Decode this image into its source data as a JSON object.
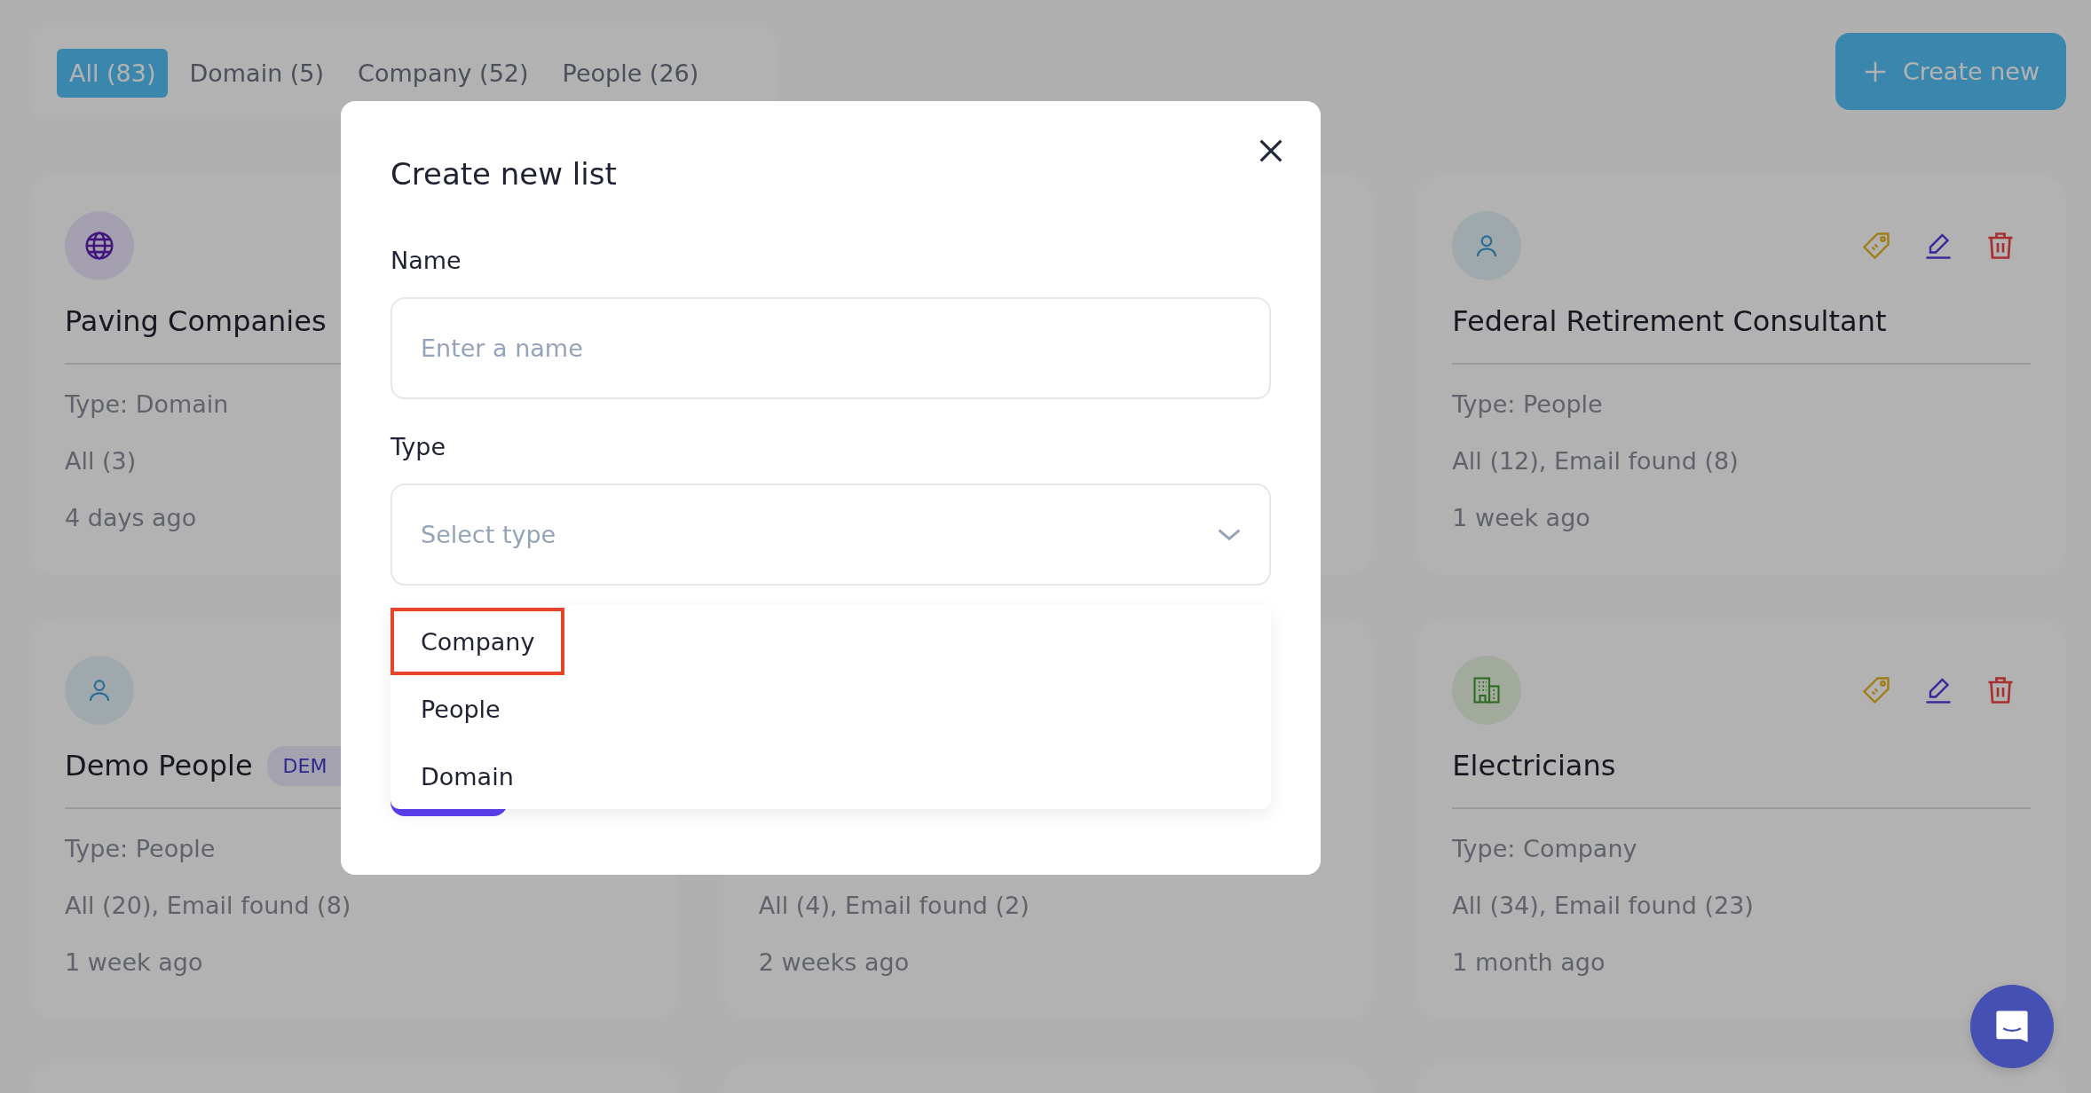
{
  "tabs": [
    {
      "label": "All (83)",
      "selected": true
    },
    {
      "label": "Domain (5)",
      "selected": false
    },
    {
      "label": "Company (52)",
      "selected": false
    },
    {
      "label": "People (26)",
      "selected": false
    }
  ],
  "create_button": {
    "label": "Create new"
  },
  "cards": [
    {
      "kind": "domain",
      "title": "Paving Companies",
      "type": "Type: Domain",
      "counts": "All (3)",
      "updated": "4 days ago"
    },
    {
      "kind": "people",
      "title": "Federal Retirement Consultant",
      "type": "Type: People",
      "counts": "All (12), Email found (8)",
      "updated": "1 week ago",
      "actions": true
    },
    {
      "kind": "people",
      "title": "Demo People",
      "badge": "DEM",
      "type": "Type: People",
      "counts": "All (20), Email found (8)",
      "updated": "1 week ago"
    },
    {
      "counts": "All (4), Email found (2)",
      "updated": "2 weeks ago"
    },
    {
      "kind": "company",
      "title": "Electricians",
      "type": "Type: Company",
      "counts": "All (34), Email found (23)",
      "updated": "1 month ago",
      "actions": true
    }
  ],
  "modal": {
    "title": "Create new list",
    "name_label": "Name",
    "name_placeholder": "Enter a name",
    "type_label": "Type",
    "type_placeholder": "Select type",
    "options": [
      {
        "label": "Company",
        "highlighted": true
      },
      {
        "label": "People",
        "highlighted": false
      },
      {
        "label": "Domain",
        "highlighted": false
      }
    ]
  }
}
